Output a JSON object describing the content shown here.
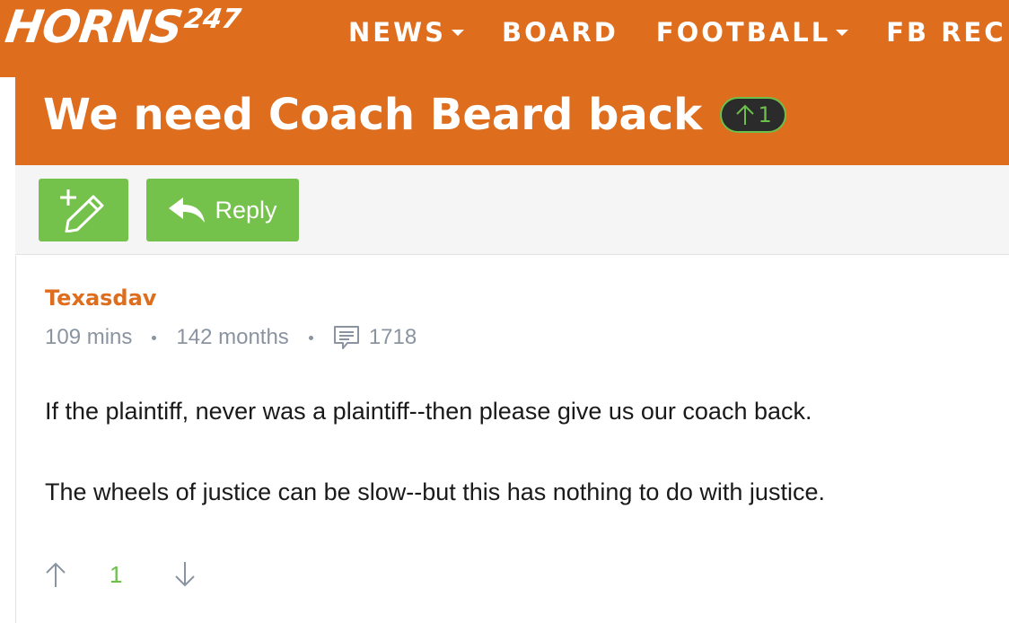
{
  "header": {
    "logo_text": "HORNS",
    "logo_superscript": "247",
    "nav": [
      {
        "label": "NEWS",
        "has_dropdown": true
      },
      {
        "label": "BOARD",
        "has_dropdown": false
      },
      {
        "label": "FOOTBALL",
        "has_dropdown": true
      },
      {
        "label": "FB REC",
        "has_dropdown": true
      }
    ]
  },
  "thread": {
    "title": "We need Coach Beard back",
    "vote_count": "1"
  },
  "toolbar": {
    "new_thread_icon": "pencil-plus-icon",
    "reply_label": "Reply"
  },
  "post": {
    "author": "Texasdav",
    "time_ago": "109 mins",
    "member_age": "142 months",
    "post_count": "1718",
    "body": [
      "If the plaintiff, never was a plaintiff--then please give us our coach back.",
      "The wheels of justice can be slow--but this has nothing to do with justice."
    ],
    "vote_count": "1"
  },
  "colors": {
    "brand_orange": "#de6d1e",
    "action_green": "#74c14c",
    "vote_green": "#6cc04a",
    "meta_gray": "#8a94a0"
  }
}
